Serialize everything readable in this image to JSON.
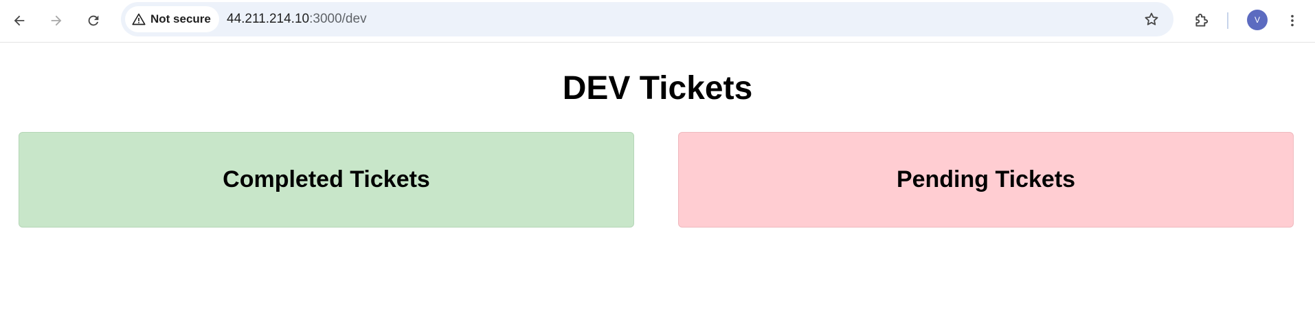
{
  "browser": {
    "security_label": "Not secure",
    "url_host": "44.211.214.10",
    "url_path": ":3000/dev",
    "profile_initial": "V",
    "icons": {
      "back": "arrow-left-icon",
      "forward": "arrow-right-icon",
      "reload": "reload-icon",
      "warning": "warning-triangle-icon",
      "bookmark": "star-icon",
      "extensions": "puzzle-icon",
      "menu": "more-vert-icon"
    },
    "colors": {
      "omnibox_bg": "#edf2fa",
      "avatar_bg": "#5c6bc0"
    }
  },
  "page": {
    "title": "DEV Tickets",
    "cards": {
      "completed": {
        "label": "Completed Tickets",
        "color": "#c8e6c9"
      },
      "pending": {
        "label": "Pending Tickets",
        "color": "#ffcdd2"
      }
    }
  }
}
